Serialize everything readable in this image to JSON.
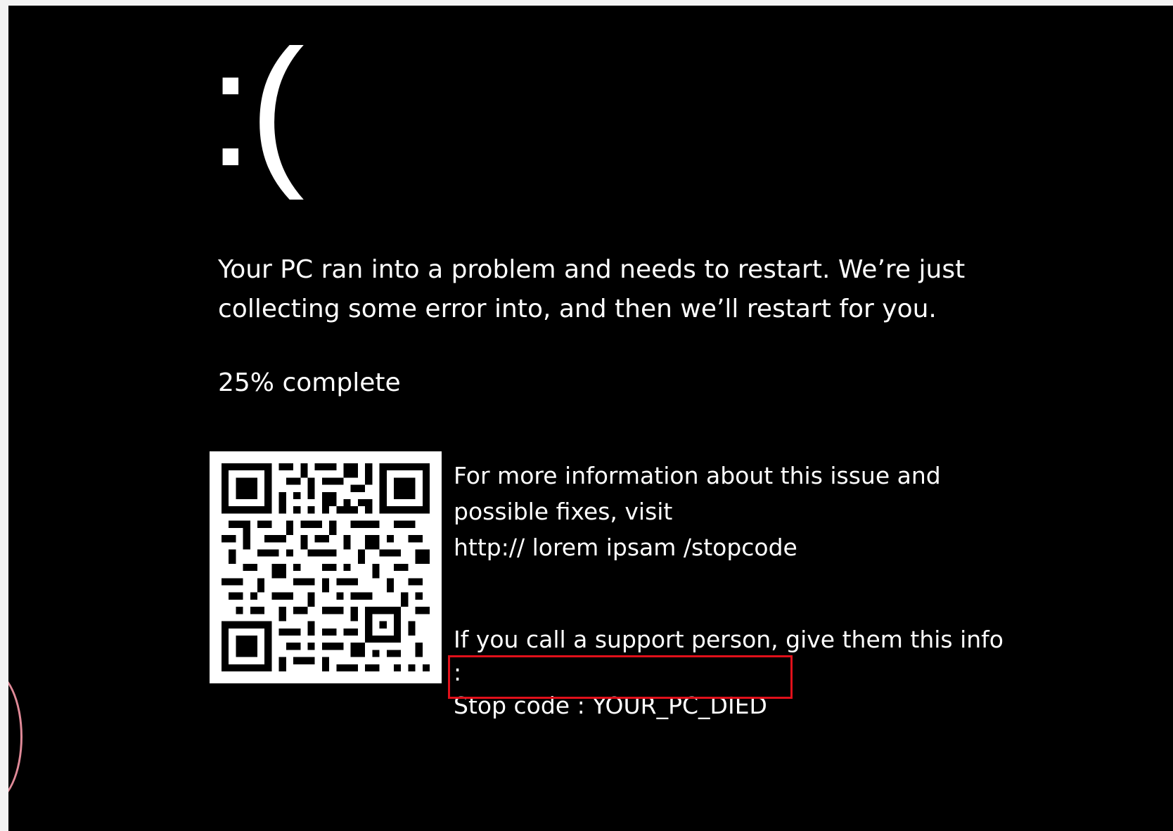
{
  "screen": {
    "background_color": "#000000",
    "text_color": "#ffffff",
    "highlight_color": "#e0101a",
    "frown": ":(",
    "message": "Your PC ran into a problem and needs to restart. We’re just collecting some error into, and then we’ll restart for you.",
    "progress_text": "25% complete",
    "progress_percent": 25,
    "info_line_1": "For more information  about this issue and possible fixes, visit",
    "info_url": "http:// lorem ipsam /stopcode",
    "support_text": "If you call a support person, give them this info :",
    "stop_code_text": "Stop code : YOUR_PC_DIED",
    "qr_icon": "qr-code-icon"
  }
}
